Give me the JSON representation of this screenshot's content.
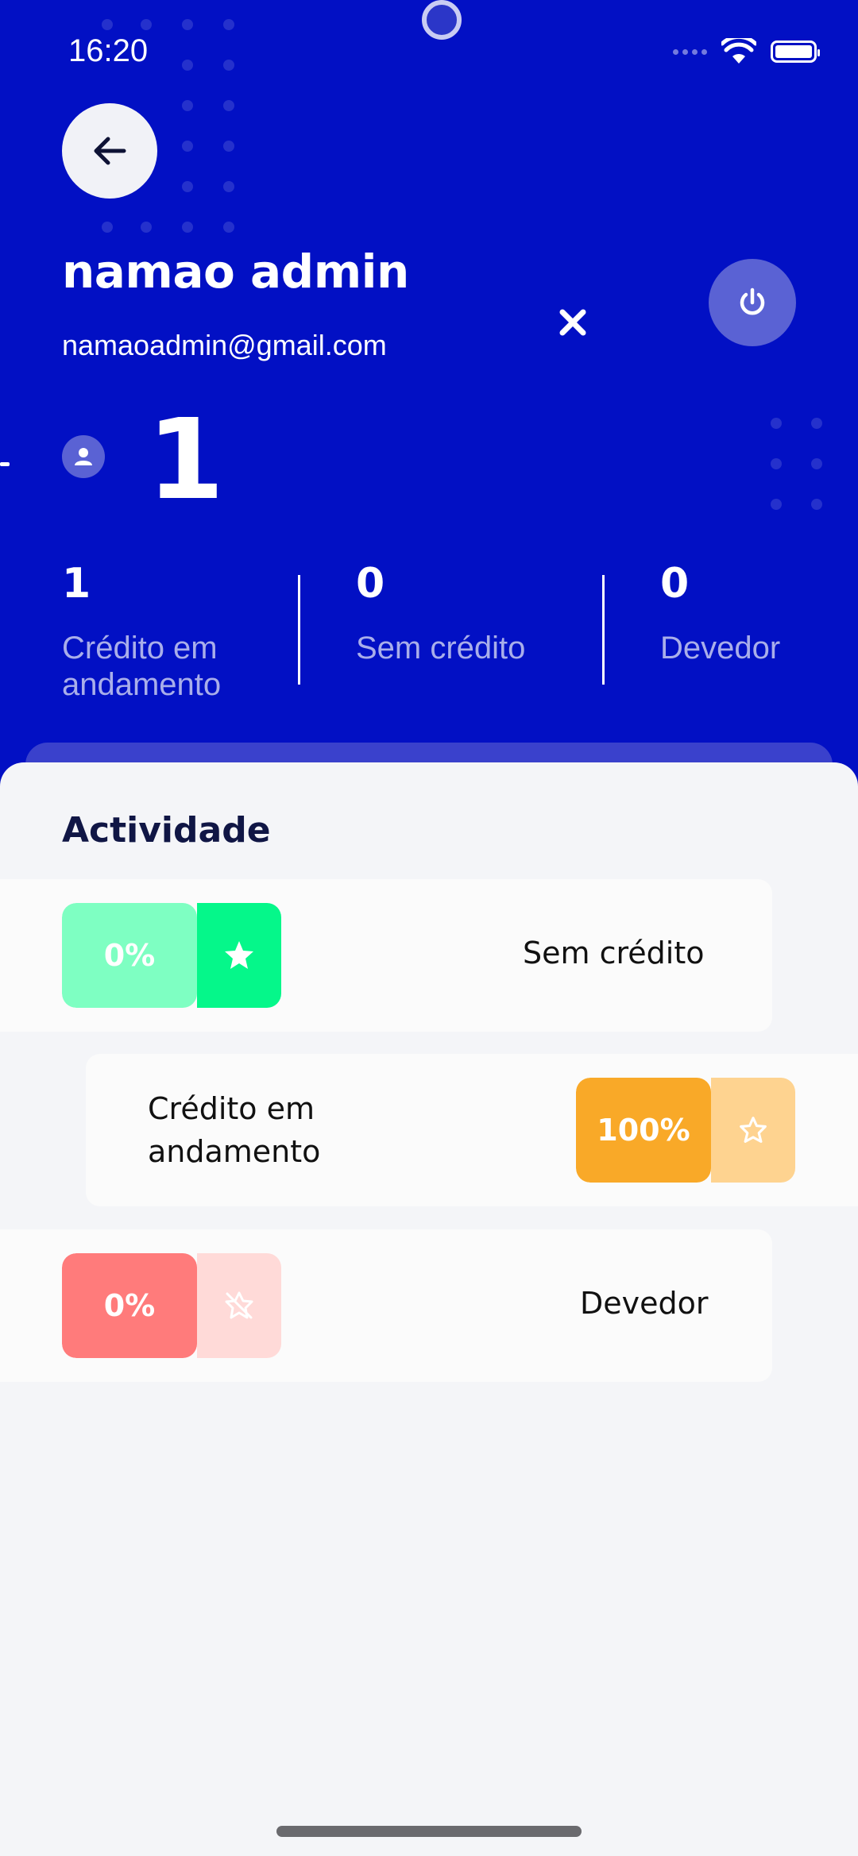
{
  "status_bar": {
    "time": "16:20"
  },
  "profile": {
    "name": "namao admin",
    "email": "namaoadmin@gmail.com",
    "client_count": "1"
  },
  "stats": [
    {
      "value": "1",
      "label": "Crédito em andamento"
    },
    {
      "value": "0",
      "label": "Sem crédito"
    },
    {
      "value": "0",
      "label": "Devedor"
    }
  ],
  "activity": {
    "title": "Actividade",
    "items": [
      {
        "label": "Sem crédito",
        "percent": "0%",
        "icon": "star-filled-icon",
        "color": "#7effc2",
        "accent": "#05f78a"
      },
      {
        "label": "Crédito em andamento",
        "percent": "100%",
        "icon": "star-outline-icon",
        "color": "#f9a928",
        "accent": "#fed390"
      },
      {
        "label": "Devedor",
        "percent": "0%",
        "icon": "star-off-icon",
        "color": "#ff7b7b",
        "accent": "#ffdad8"
      }
    ]
  },
  "colors": {
    "hero": "#0210c4",
    "sheet": "#f4f5f8",
    "title": "#101645"
  }
}
